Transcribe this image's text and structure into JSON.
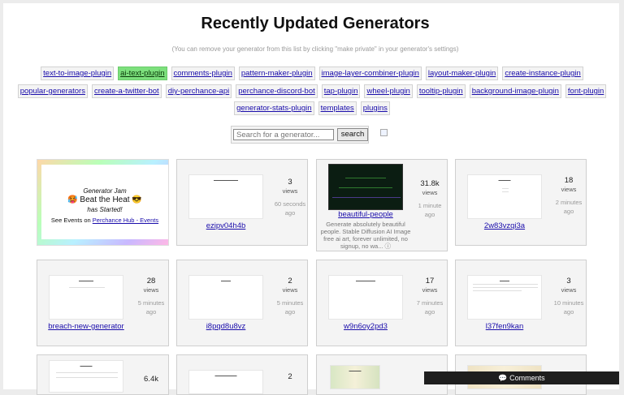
{
  "title": "Recently Updated Generators",
  "subtitle": "(You can remove your generator from this list by clicking \"make private\" in your generator's settings)",
  "tags_row1": [
    "text-to-image-plugin",
    "ai-text-plugin",
    "comments-plugin",
    "pattern-maker-plugin",
    "image-layer-combiner-plugin",
    "layout-maker-plugin",
    "create-instance-plugin"
  ],
  "tags_row2": [
    "popular-generators",
    "create-a-twitter-bot",
    "diy-perchance-api",
    "perchance-discord-bot",
    "tap-plugin",
    "wheel-plugin",
    "tooltip-plugin",
    "background-image-plugin",
    "font-plugin"
  ],
  "tags_row3": [
    "generator-stats-plugin",
    "templates",
    "plugins"
  ],
  "active_tag": "ai-text-plugin",
  "search": {
    "placeholder": "Search for a generator...",
    "button": "search"
  },
  "jam": {
    "line1": "Generator Jam",
    "line2": "🥵 Beat the Heat 😎",
    "line3": "has Started!",
    "line4_prefix": "See Events on ",
    "line4_link": "Perchance Hub - Events"
  },
  "cards": [
    {
      "name": "ezipv04h4b",
      "views": "3",
      "views_label": "views",
      "time": "60 seconds ago"
    },
    {
      "name": "beautiful-people",
      "desc": "Generate absolutely beautiful people. Stable Diffusion AI Image free ai art, forever unlimited, no signup, no wa... ⓘ",
      "views": "31.8k",
      "views_label": "views",
      "time": "1 minute ago"
    },
    {
      "name": "2w83vzqi3a",
      "views": "18",
      "views_label": "views",
      "time": "2 minutes ago"
    },
    {
      "name": "breach-new-generator",
      "views": "28",
      "views_label": "views",
      "time": "5 minutes ago"
    },
    {
      "name": "i8pqd8u8vz",
      "views": "2",
      "views_label": "views",
      "time": "5 minutes ago"
    },
    {
      "name": "w9n6oy2pd3",
      "views": "17",
      "views_label": "views",
      "time": "7 minutes ago"
    },
    {
      "name": "l37fen9kan",
      "views": "3",
      "views_label": "views",
      "time": "10 minutes ago"
    },
    {
      "views": "6.4k"
    },
    {
      "views": "2"
    }
  ],
  "comments_label": "💬 Comments"
}
